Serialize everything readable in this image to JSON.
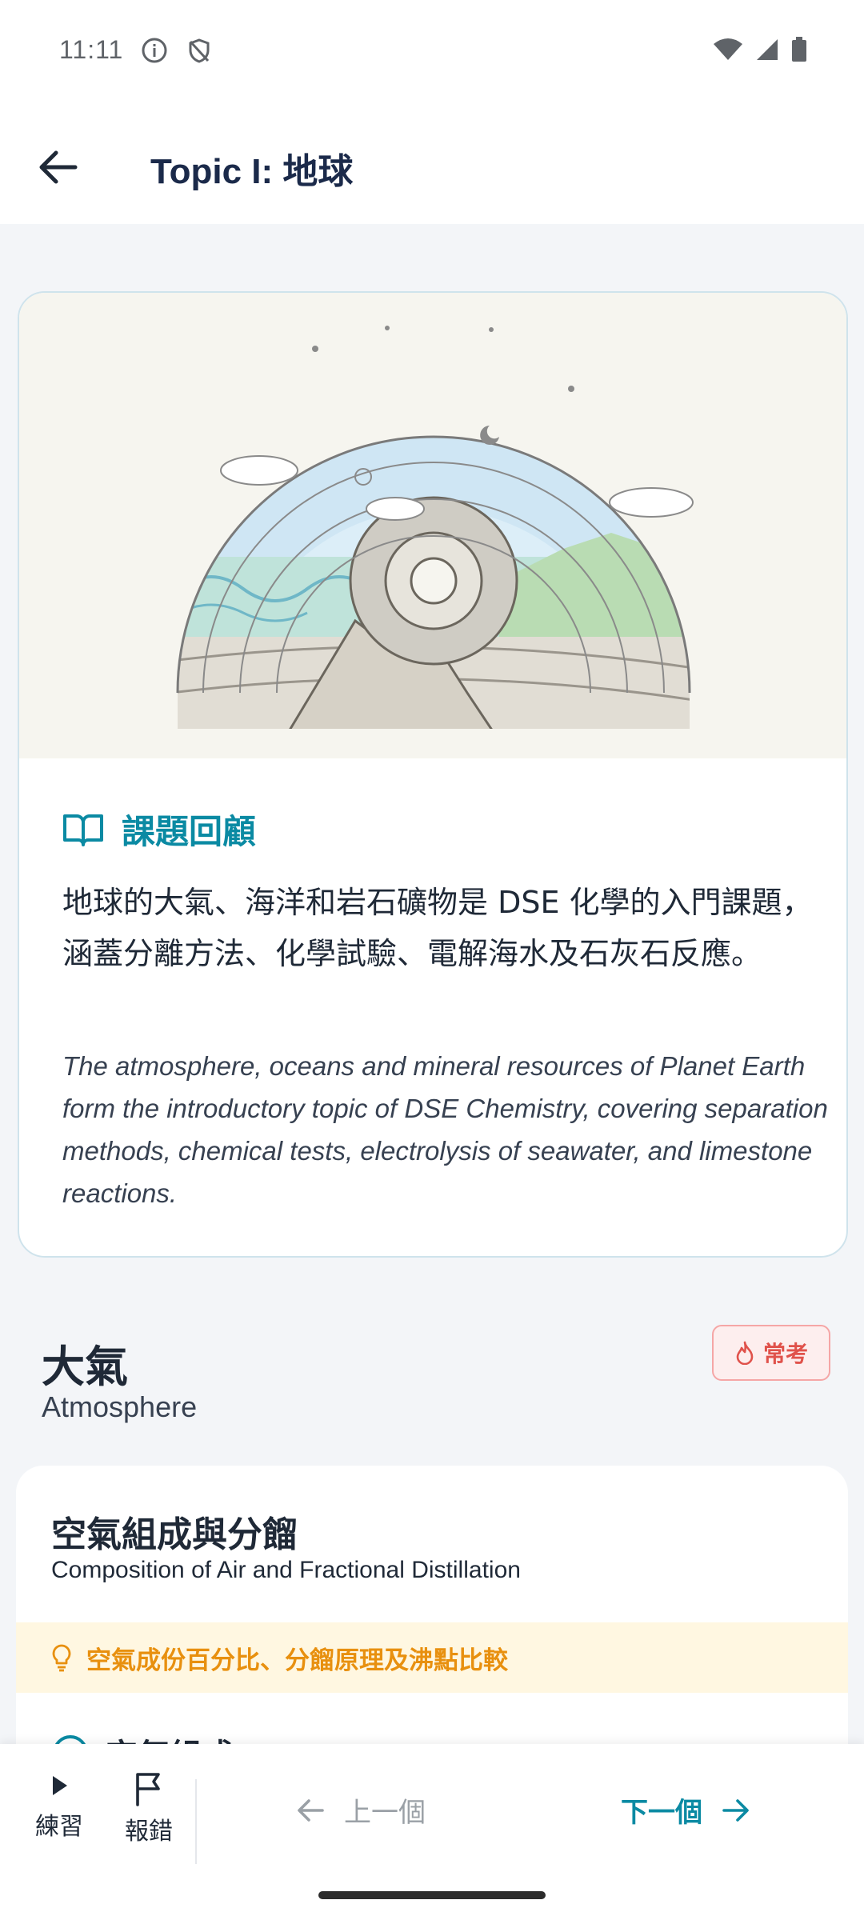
{
  "status_bar": {
    "time": "11:11"
  },
  "app_bar": {
    "title": "Topic I: 地球"
  },
  "review": {
    "heading": "課題回顧",
    "body_zh": "地球的大氣、海洋和岩石礦物是 DSE 化學的入門課題，涵蓋分離方法、化學試驗、電解海水及石灰石反應。",
    "body_en": "The atmosphere, oceans and mineral resources of Planet Earth form the introductory topic of DSE Chemistry, covering separation methods, chemical tests, electrolysis of seawater, and limestone reactions."
  },
  "section": {
    "title_zh": "大氣",
    "title_en": "Atmosphere",
    "badge": "常考"
  },
  "subtopic": {
    "title_zh": "空氣組成與分餾",
    "title_en": "Composition of Air and Fractional Distillation",
    "hint": "空氣成份百分比、分餾原理及沸點比較",
    "peek": "空氣組成"
  },
  "bottom_bar": {
    "practice_label": "練習",
    "report_label": "報錯",
    "prev_label": "上一個",
    "next_label": "下一個"
  },
  "colors": {
    "accent": "#0b8aa3",
    "badge_red": "#e0524b",
    "hint_orange": "#e8900f",
    "title_navy": "#1b2a4a"
  }
}
